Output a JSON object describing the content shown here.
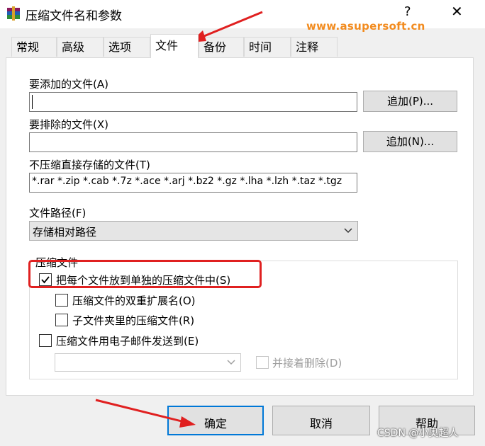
{
  "window": {
    "title": "压缩文件名和参数",
    "help_glyph": "?",
    "close_glyph": "✕"
  },
  "watermarks": {
    "top": "www.asupersoft.cn",
    "bottom": "CSDN @小奥超人"
  },
  "tabs": [
    {
      "label": "常规"
    },
    {
      "label": "高级"
    },
    {
      "label": "选项"
    },
    {
      "label": "文件",
      "active": true
    },
    {
      "label": "备份"
    },
    {
      "label": "时间"
    },
    {
      "label": "注释"
    }
  ],
  "files": {
    "add_label": "要添加的文件(A)",
    "add_value": "",
    "add_button": "追加(P)...",
    "exclude_label": "要排除的文件(X)",
    "exclude_value": "",
    "exclude_button": "追加(N)...",
    "store_label": "不压缩直接存储的文件(T)",
    "store_value": "*.rar *.zip *.cab *.7z *.ace *.arj *.bz2 *.gz *.lha *.lzh *.taz *.tgz"
  },
  "path": {
    "label": "文件路径(F)",
    "selected": "存储相对路径"
  },
  "archives": {
    "group_title": "压缩文件",
    "separate": {
      "label": "把每个文件放到单独的压缩文件中(S)",
      "checked": true
    },
    "double_ext": {
      "label": "压缩文件的双重扩展名(O)",
      "checked": false
    },
    "subfolders": {
      "label": "子文件夹里的压缩文件(R)",
      "checked": false
    },
    "email": {
      "label": "压缩文件用电子邮件发送到(E)",
      "checked": false
    },
    "email_target": "",
    "delete_after": {
      "label": "并接着删除(D)",
      "checked": false
    }
  },
  "buttons": {
    "ok": "确定",
    "cancel": "取消",
    "help": "帮助"
  },
  "accent_colors": {
    "annotation_red": "#e02020",
    "watermark_orange": "#f28b1e",
    "focus_blue": "#0078d7"
  }
}
